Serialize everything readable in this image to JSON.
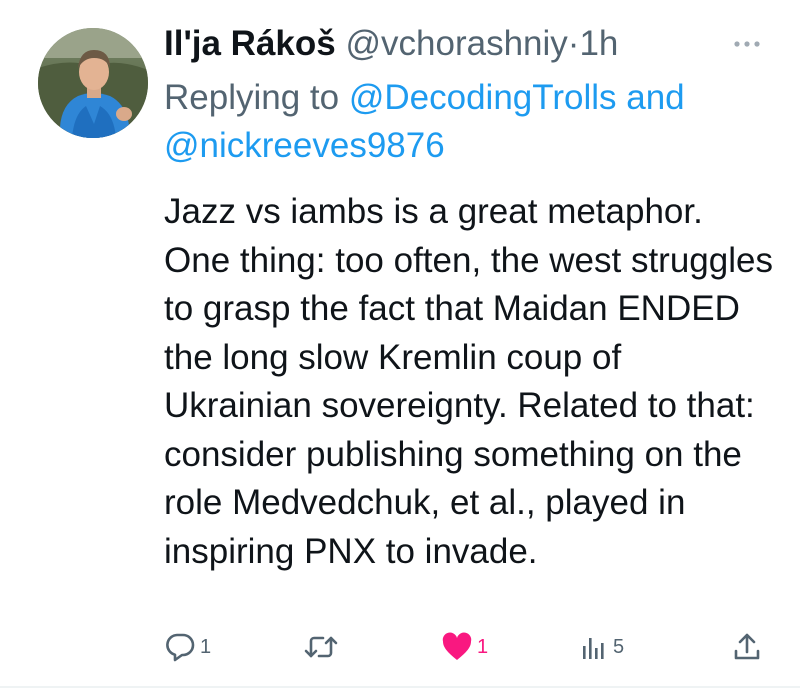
{
  "tweet": {
    "author": {
      "display_name": "Il'ja Rákoš",
      "handle": "@vchorashniy",
      "time_separator": "·",
      "time": "1h"
    },
    "reply": {
      "prefix": "Replying to",
      "mention1": "@DecodingTrolls",
      "conjunction": "and",
      "mention2": "@nickreeves9876"
    },
    "body": "Jazz vs iambs is a great metaphor. One thing: too often, the west struggles to grasp the fact that Maidan ENDED the long slow Kremlin coup of Ukrainian sovereignty. Related to that: consider publishing something on the role Medvedchuk, et al., played in inspiring PNX to invade.",
    "actions": {
      "replies": "1",
      "retweets": "",
      "likes": "1",
      "views": "5"
    },
    "icons": {
      "more": "more-horizontal-icon",
      "reply": "reply-bubble-icon",
      "retweet": "retweet-icon",
      "like": "heart-filled-icon",
      "views": "bar-chart-icon",
      "share": "share-upload-icon"
    },
    "colors": {
      "link": "#1d9bf0",
      "secondary_text": "#536471",
      "primary_text": "#0f1419",
      "like": "#f91880"
    }
  }
}
